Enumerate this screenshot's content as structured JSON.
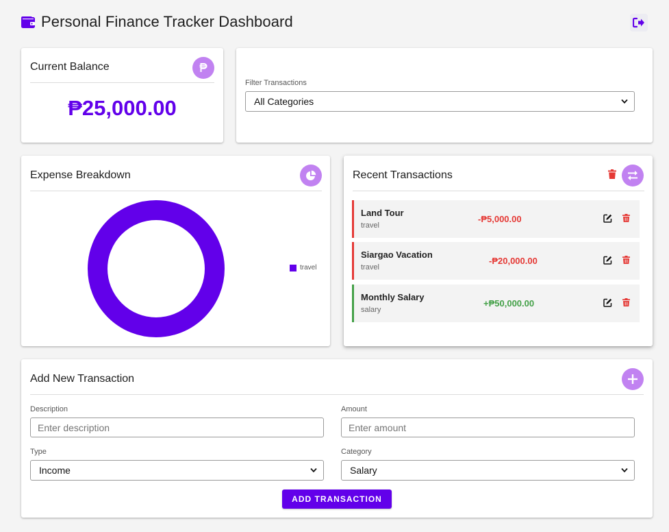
{
  "header": {
    "title": "Personal Finance Tracker Dashboard",
    "wallet_icon": "wallet-icon",
    "logout_icon": "sign-out-icon"
  },
  "colors": {
    "accent": "#6200ea",
    "icon_bg": "#c182f1",
    "expense": "#e53935",
    "income": "#43a047"
  },
  "balance": {
    "title": "Current Balance",
    "amount": "₱25,000.00",
    "icon": "peso-icon"
  },
  "filter": {
    "label": "Filter Transactions",
    "selected": "All Categories"
  },
  "expense_breakdown": {
    "title": "Expense Breakdown",
    "icon": "pie-chart-icon",
    "legend": [
      {
        "label": "travel",
        "color": "#6200ea"
      }
    ]
  },
  "recent": {
    "title": "Recent Transactions",
    "icon": "exchange-icon",
    "transactions": [
      {
        "name": "Land Tour",
        "category": "travel",
        "amount": "-₱5,000.00",
        "type": "expense"
      },
      {
        "name": "Siargao Vacation",
        "category": "travel",
        "amount": "-₱20,000.00",
        "type": "expense"
      },
      {
        "name": "Monthly Salary",
        "category": "salary",
        "amount": "+₱50,000.00",
        "type": "income"
      }
    ]
  },
  "add_form": {
    "title": "Add New Transaction",
    "icon": "plus-icon",
    "description_label": "Description",
    "description_placeholder": "Enter description",
    "amount_label": "Amount",
    "amount_placeholder": "Enter amount",
    "type_label": "Type",
    "type_selected": "Income",
    "category_label": "Category",
    "category_selected": "Salary",
    "submit_label": "ADD TRANSACTION"
  },
  "chart_data": {
    "type": "pie",
    "categories": [
      "travel"
    ],
    "values": [
      25000
    ],
    "title": "",
    "legend_position": "right"
  }
}
